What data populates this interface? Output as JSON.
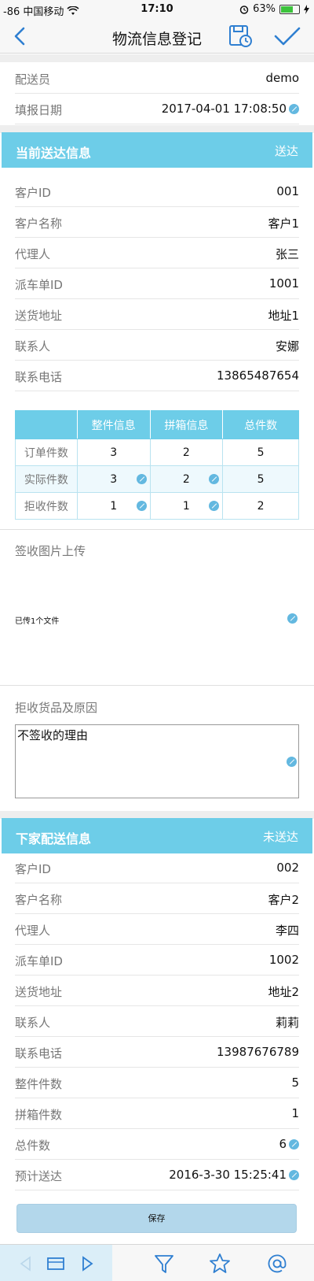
{
  "status": {
    "carrier": "-86 中国移动",
    "time": "17:10",
    "battery": "63%"
  },
  "nav": {
    "title": "物流信息登记"
  },
  "header_rows": [
    {
      "label": "配送员",
      "value": "demo"
    },
    {
      "label": "填报日期",
      "value": "2017-04-01 17:08:50"
    }
  ],
  "current": {
    "title": "当前送达信息",
    "status": "送达",
    "rows": [
      {
        "label": "客户ID",
        "value": "001"
      },
      {
        "label": "客户名称",
        "value": "客户1"
      },
      {
        "label": "代理人",
        "value": "张三"
      },
      {
        "label": "派车单ID",
        "value": "1001"
      },
      {
        "label": "送货地址",
        "value": "地址1"
      },
      {
        "label": "联系人",
        "value": "安娜"
      },
      {
        "label": "联系电话",
        "value": "13865487654"
      }
    ],
    "table": {
      "headers": [
        "",
        "整件信息",
        "拼箱信息",
        "总件数"
      ],
      "rows": [
        [
          "订单件数",
          "3",
          "2",
          "5"
        ],
        [
          "实际件数",
          "3",
          "2",
          "5"
        ],
        [
          "拒收件数",
          "1",
          "1",
          "2"
        ]
      ]
    }
  },
  "upload": {
    "label": "签收图片上传",
    "status": "已传1个文件"
  },
  "reject": {
    "label": "拒收货品及原因",
    "text": "不签收的理由"
  },
  "next": {
    "title": "下家配送信息",
    "status": "未送达",
    "rows": [
      {
        "label": "客户ID",
        "value": "002"
      },
      {
        "label": "客户名称",
        "value": "客户2"
      },
      {
        "label": "代理人",
        "value": "李四"
      },
      {
        "label": "派车单ID",
        "value": "1002"
      },
      {
        "label": "送货地址",
        "value": "地址2"
      },
      {
        "label": "联系人",
        "value": "莉莉"
      },
      {
        "label": "联系电话",
        "value": "13987676789"
      },
      {
        "label": "整件件数",
        "value": "5"
      },
      {
        "label": "拼箱件数",
        "value": "1"
      },
      {
        "label": "总件数",
        "value": "6"
      },
      {
        "label": "预计送达",
        "value": "2016-3-30 15:25:41"
      }
    ]
  },
  "save_label": "保存",
  "colors": {
    "accent": "#6dcde8",
    "nav_icon": "#2f7fd1",
    "save_button": "#b3d7eb"
  }
}
